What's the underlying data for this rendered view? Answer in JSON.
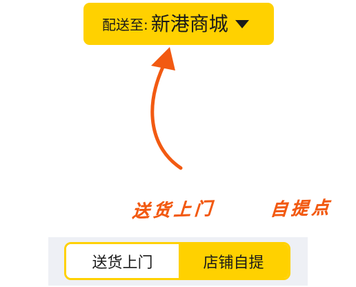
{
  "address_selector": {
    "prefix": "配送至:",
    "value": "新港商城",
    "caret_icon": "caret-down-icon"
  },
  "annotations": {
    "delivery_note": "送货上门",
    "pickup_note": "自提点",
    "color": "#F25A12"
  },
  "delivery_mode_tabs": {
    "items": [
      {
        "label": "送货上门"
      },
      {
        "label": "店铺自提"
      }
    ],
    "selected": "店铺自提"
  },
  "colors": {
    "accent": "#FFD100",
    "segment_background": "#EEF0F5"
  }
}
